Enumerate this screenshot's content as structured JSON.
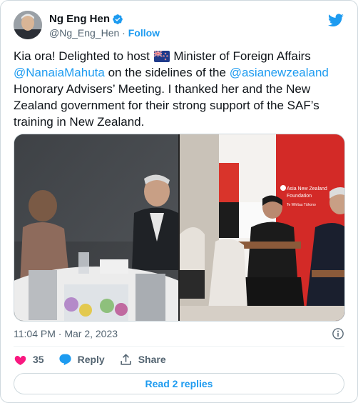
{
  "author": {
    "name": "Ng Eng Hen",
    "handle": "@Ng_Eng_Hen",
    "separator": "·",
    "follow_label": "Follow"
  },
  "tweet": {
    "text_intro": "Kia ora! Delighted to host ",
    "text_after_flag": " Minister of Foreign Affairs ",
    "mention_1": "@NanaiaMahuta",
    "text_mid": " on the sidelines of the ",
    "mention_2": "@asianewzealand",
    "text_end": " Honorary Advisers’ Meeting. I thanked her and the New Zealand government for their strong support of the SAF’s training in New Zealand.",
    "flag_icon": "new-zealand-flag-icon"
  },
  "media": {
    "photo_left_icon": "meeting-dinner-photo",
    "photo_right_icon": "meeting-chairs-photo",
    "banner_text_1": "Asia New Zealand",
    "banner_text_2": "Foundation",
    "banner_text_3": "Te Whītau Tūhono"
  },
  "meta": {
    "timestamp": "11:04 PM · Mar 2, 2023"
  },
  "actions": {
    "like_count": "35",
    "reply_label": "Reply",
    "share_label": "Share",
    "read_replies_label": "Read 2 replies"
  },
  "colors": {
    "accent": "#1d9bf0",
    "like": "#f91880",
    "text": "#0f1419",
    "secondary": "#536471",
    "border": "#cfd9de"
  }
}
